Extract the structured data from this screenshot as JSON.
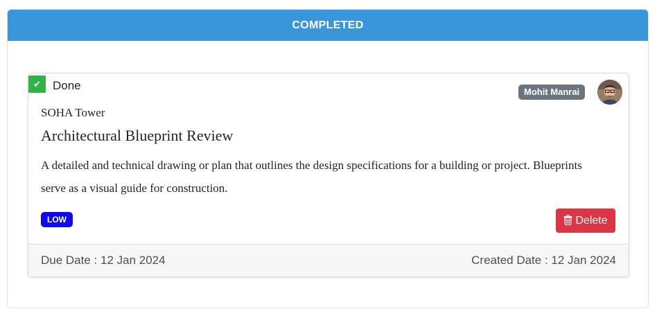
{
  "column": {
    "header": "COMPLETED",
    "header_color": "#3a96db"
  },
  "task": {
    "status_label": "Done",
    "status_color": "#2fb344",
    "assignee": "Mohit Manrai",
    "project": "SOHA Tower",
    "title": "Architectural Blueprint Review",
    "description": "A detailed and technical drawing or plan that outlines the design specifications for a building or project. Blueprints serve as a visual guide for construction.",
    "priority": "LOW",
    "priority_color": "#1208f0",
    "delete_label": "Delete",
    "delete_color": "#dc3545",
    "due_date": "Due Date : 12 Jan 2024",
    "created_date": "Created Date : 12 Jan 2024"
  },
  "icons": {
    "status": "check-icon",
    "delete": "trash-icon",
    "avatar": "user-avatar"
  }
}
